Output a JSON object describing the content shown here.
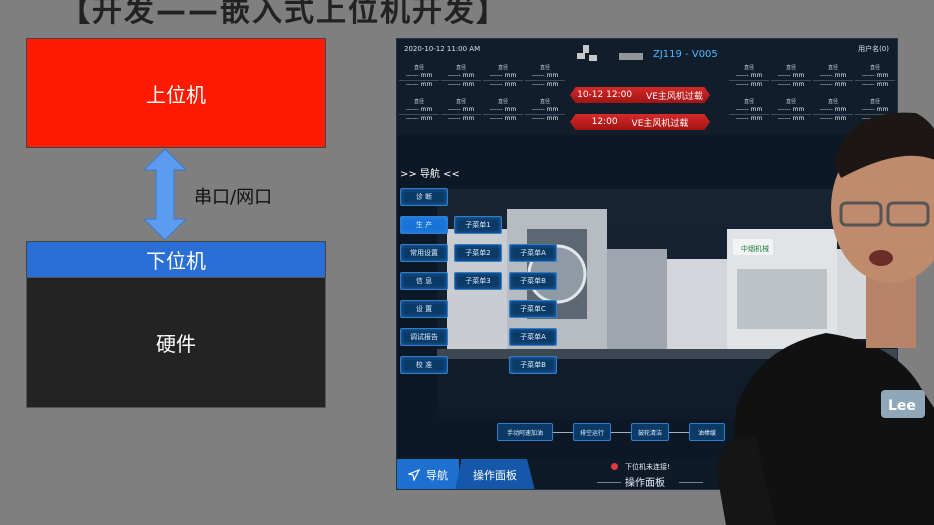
{
  "slide": {
    "title": "【开发——嵌入式上位机开发】",
    "upper_box": "上位机",
    "link_label": "串口/网口",
    "lower_box": "下位机",
    "hardware_box": "硬件"
  },
  "hmi": {
    "datetime": "2020-10-12 11:00 AM",
    "user": "用户名(0)",
    "model": "ZJ119 - V005",
    "gauge_label": "直径",
    "gauge_value": "------ mm",
    "alarms": [
      {
        "time": "10-12 12:00",
        "text": "VE主风机过载"
      },
      {
        "time": "12:00",
        "text": "VE主风机过载"
      }
    ],
    "nav_title": ">> 导航 <<",
    "nav_buttons": [
      "诊 断",
      "生 产",
      "常用设置",
      "信 息",
      "设 置",
      "调试报告",
      "校 准"
    ],
    "submenu_col1": [
      "子菜单1",
      "子菜单2",
      "子菜单3"
    ],
    "submenu_col2": [
      "子菜单A",
      "子菜单B",
      "子菜单C",
      "子菜单A",
      "子菜单B"
    ],
    "flow_buttons": [
      "手动阿速加油",
      "排空运行",
      "鼓轮清洁",
      "油棒缓"
    ],
    "status_text": "下位机未连接!",
    "tab_nav": "导航",
    "tab_operation": "操作面板",
    "panel_label": "操作面板",
    "machine_brand": "中烟机械",
    "colors": {
      "accent": "#1d6fd0",
      "alarm": "#d42a2a",
      "model": "#49b8ff"
    }
  },
  "presenter": {
    "shirt_logo": "Lee"
  }
}
